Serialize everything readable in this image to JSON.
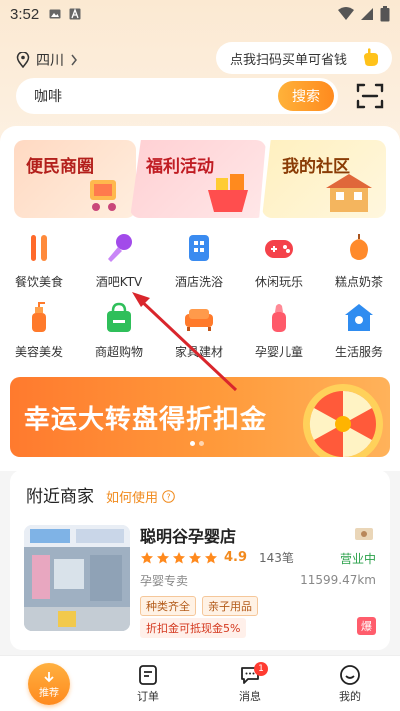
{
  "status_bar": {
    "time": "3:52"
  },
  "header": {
    "location": "四川",
    "scan_tip": "点我扫码买单可省钱",
    "search_value": "咖啡",
    "search_button": "搜索"
  },
  "promos": [
    {
      "label": "便民商圈"
    },
    {
      "label": "福利活动"
    },
    {
      "label": "我的社区"
    }
  ],
  "categories": [
    {
      "label": "餐饮美食",
      "icon": "utensils-icon"
    },
    {
      "label": "酒吧KTV",
      "icon": "microphone-icon"
    },
    {
      "label": "酒店洗浴",
      "icon": "hotel-icon"
    },
    {
      "label": "休闲玩乐",
      "icon": "gamepad-icon"
    },
    {
      "label": "糕点奶茶",
      "icon": "acorn-icon"
    },
    {
      "label": "美容美发",
      "icon": "lotion-icon"
    },
    {
      "label": "商超购物",
      "icon": "shopping-bag-icon"
    },
    {
      "label": "家具建材",
      "icon": "sofa-icon"
    },
    {
      "label": "孕婴儿童",
      "icon": "baby-bottle-icon"
    },
    {
      "label": "生活服务",
      "icon": "home-service-icon"
    }
  ],
  "banner": {
    "title": "幸运大转盘得折扣金"
  },
  "nearby": {
    "title": "附近商家",
    "how_to_use": "如何使用",
    "shop": {
      "name": "聪明谷孕婴店",
      "rating": "4.9",
      "orders": "143笔",
      "status": "营业中",
      "category": "孕婴专卖",
      "distance": "11599.47km",
      "tags": [
        "种类齐全",
        "亲子用品"
      ],
      "cash_note": "折扣金可抵现金5%",
      "hot_label": "爆",
      "stars": 5
    }
  },
  "bottom_nav": {
    "recommend": "推荐",
    "orders": "订单",
    "messages": "消息",
    "messages_badge": "1",
    "mine": "我的"
  },
  "colors": {
    "accent": "#ff8a1e",
    "open_green": "#2aa14a",
    "annotation_red": "#d9262c"
  }
}
